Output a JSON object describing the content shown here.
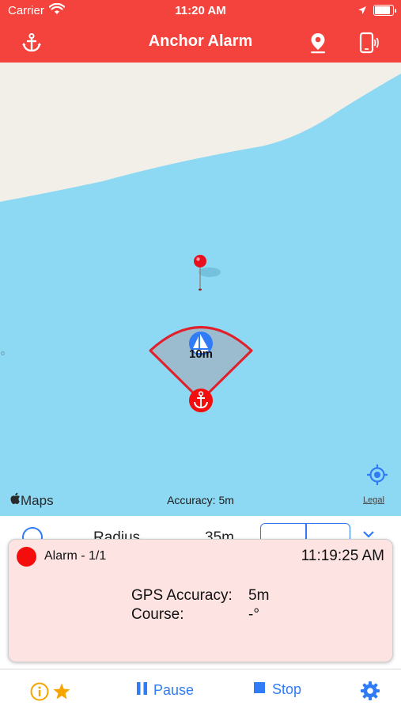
{
  "status_bar": {
    "carrier": "Carrier",
    "time": "11:20 AM"
  },
  "nav": {
    "title": "Anchor Alarm",
    "left_icon": "anchor-icon",
    "right_icons": [
      "map-pin-icon",
      "phone-vibrate-icon"
    ]
  },
  "map": {
    "watch_radius_label": "10m",
    "accuracy_text": "Accuracy: 5m",
    "maps_brand": "Maps",
    "legal_link": "Legal",
    "colors": {
      "water": "#8dd8f2",
      "land": "#f2efe9",
      "zone": "#e0202a",
      "boat": "#2f7cf6"
    }
  },
  "controls": {
    "radius_label": "Radius",
    "radius_value": "35m",
    "stepper": [
      "-",
      "+"
    ]
  },
  "alarm_card": {
    "title": "Alarm - 1/1",
    "time": "11:19:25 AM",
    "gps_label": "GPS Accuracy:",
    "gps_value": "5m",
    "course_label": "Course:",
    "course_value": "-°"
  },
  "tabbar": {
    "pause_label": "Pause",
    "stop_label": "Stop"
  },
  "theme": {
    "accent": "#f4423c",
    "link": "#2f7cf6",
    "star": "#f7a400",
    "alarm_bg": "#fde4e3"
  }
}
